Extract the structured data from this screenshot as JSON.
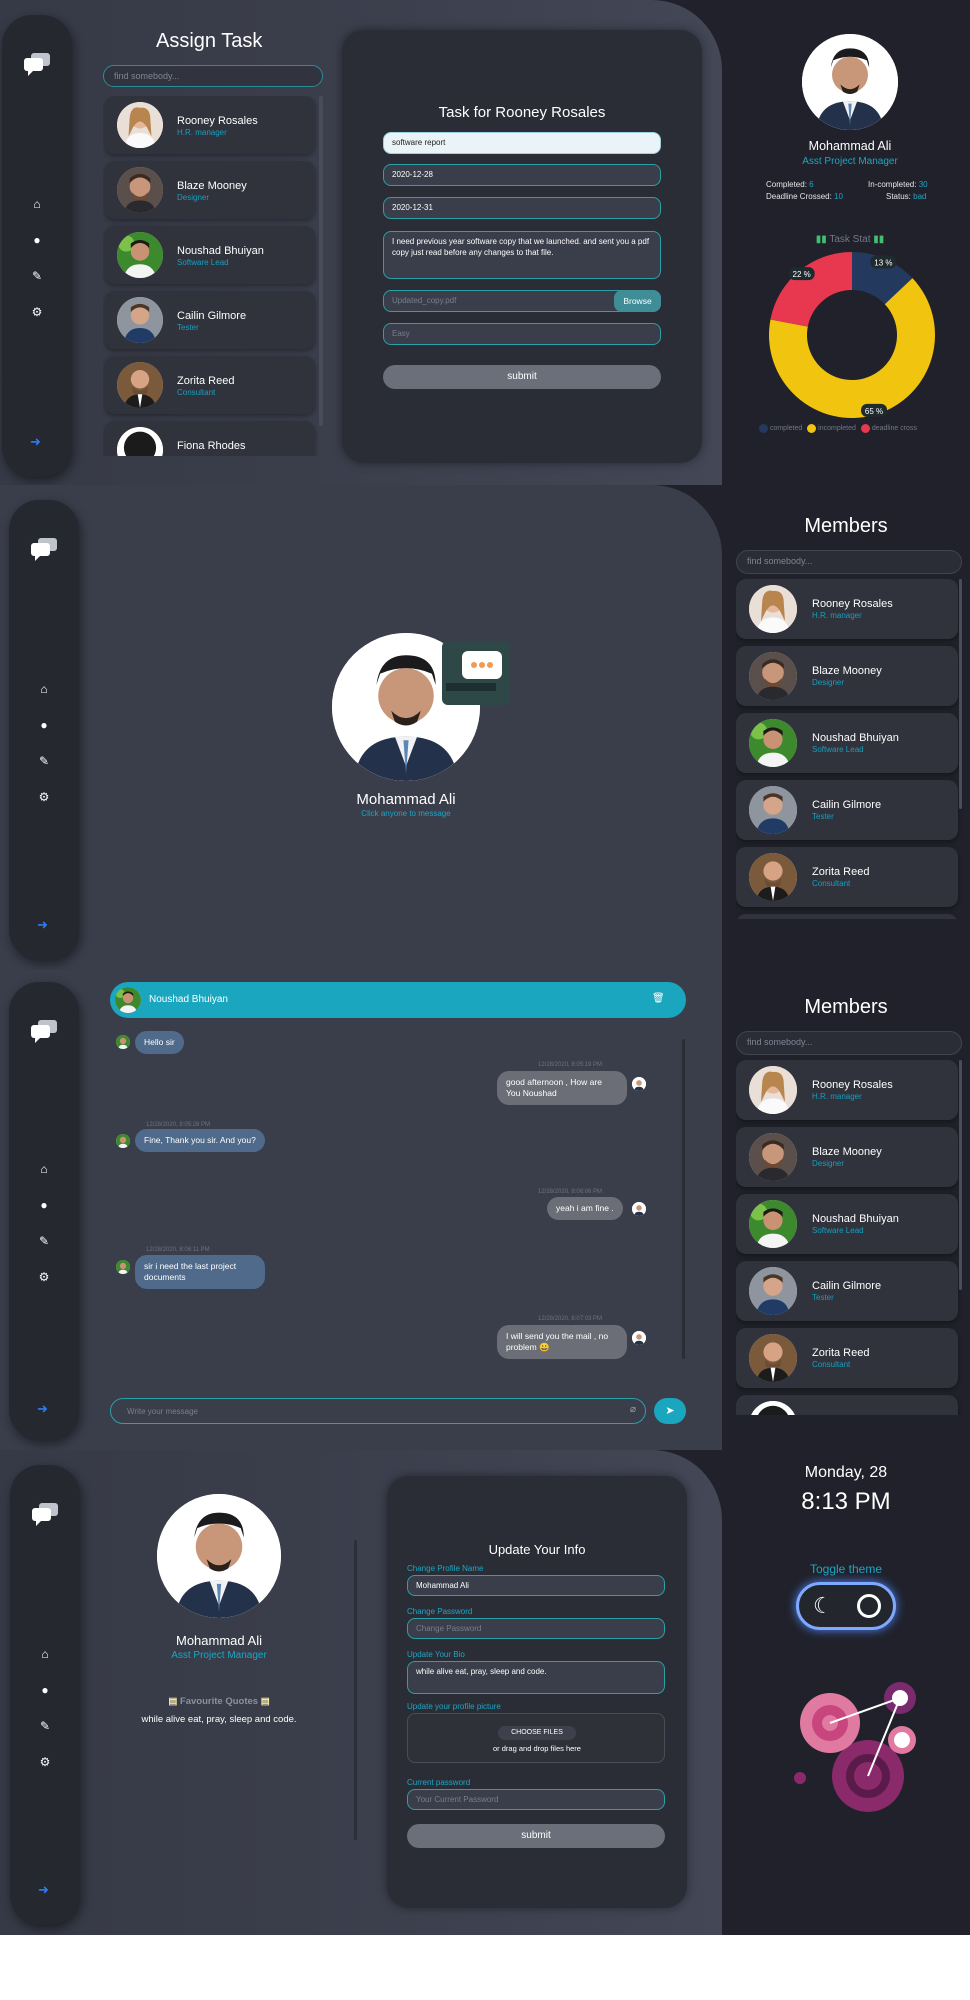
{
  "assign": {
    "title": "Assign Task",
    "search_placeholder": "find somebody...",
    "members": [
      {
        "name": "Rooney Rosales",
        "role": "H.R. manager"
      },
      {
        "name": "Blaze Mooney",
        "role": "Designer"
      },
      {
        "name": "Noushad Bhuiyan",
        "role": "Software Lead"
      },
      {
        "name": "Cailin Gilmore",
        "role": "Tester"
      },
      {
        "name": "Zorita Reed",
        "role": "Consultant"
      },
      {
        "name": "Fiona Rhodes",
        "role": ""
      }
    ],
    "form": {
      "title": "Task for Rooney Rosales",
      "task_value": "software report",
      "start_date": "2020-12-28",
      "end_date": "2020-12-31",
      "description": "I need previous year software copy that we launched. and  sent you a pdf copy just read before any changes to that file.",
      "file_placeholder": "Updated_copy.pdf",
      "browse_label": "Browse",
      "difficulty_placeholder": "Easy",
      "submit_label": "submit"
    }
  },
  "profile": {
    "name": "Mohammad Ali",
    "role": "Asst Project Manager",
    "completed_label": "Completed:",
    "completed_value": "6",
    "incompleted_label": "In-completed:",
    "incompleted_value": "30",
    "deadline_label": "Deadline Crossed:",
    "deadline_value": "10",
    "status_label": "Status:",
    "status_value": "bad",
    "task_stat_title": "Task Stat",
    "chart_data": {
      "type": "pie",
      "categories": [
        "completed",
        "incompleted",
        "deadline cross"
      ],
      "values": [
        13,
        65,
        22
      ],
      "colors": [
        "#233a5e",
        "#f1c40f",
        "#e8384f"
      ],
      "value_labels": [
        "13 %",
        "65 %",
        "22 %"
      ]
    }
  },
  "chat_home": {
    "name": "Mohammad Ali",
    "hint": "Click anyone to message"
  },
  "members_panel": {
    "title": "Members",
    "search_placeholder": "find somebody...",
    "members": [
      {
        "name": "Rooney Rosales",
        "role": "H.R. manager"
      },
      {
        "name": "Blaze Mooney",
        "role": "Designer"
      },
      {
        "name": "Noushad Bhuiyan",
        "role": "Software Lead"
      },
      {
        "name": "Cailin Gilmore",
        "role": "Tester"
      },
      {
        "name": "Zorita Reed",
        "role": "Consultant"
      }
    ]
  },
  "chat": {
    "contact_name": "Noushad Bhuiyan",
    "messages": [
      {
        "dir": "in",
        "text": "Hello sir",
        "time": ""
      },
      {
        "dir": "out",
        "text": "good afternoon , How are You Noushad",
        "time": "12/28/2020, 8:05:19 PM"
      },
      {
        "dir": "in",
        "text": "Fine, Thank you sir. And you?",
        "time": "12/28/2020, 8:05:28 PM"
      },
      {
        "dir": "out",
        "text": "yeah i am fine .",
        "time": "12/28/2020, 8:06:06 PM"
      },
      {
        "dir": "in",
        "text": "sir i need the last project documents",
        "time": "12/28/2020, 8:06:11 PM"
      },
      {
        "dir": "out",
        "text": "I will send you the mail , no problem 😀",
        "time": "12/28/2020, 8:07:03 PM"
      }
    ],
    "input_placeholder": "Write your message"
  },
  "settings": {
    "name": "Mohammad Ali",
    "role": "Asst Project Manager",
    "quotes_title": "Favourite Quotes",
    "quote": "while alive eat, pray, sleep and code.",
    "form": {
      "title": "Update Your Info",
      "name_label": "Change Profile Name",
      "name_value": "Mohammad Ali",
      "password_label": "Change Password",
      "password_placeholder": "Change Password",
      "bio_label": "Update Your Bio",
      "bio_value": "while alive eat, pray, sleep and code.",
      "picture_label": "Update your profile picture",
      "choose_label": "CHOOSE FILES",
      "drag_label": "or drag and drop files here",
      "current_label": "Current password",
      "current_placeholder": "Your Current Password",
      "submit_label": "submit"
    },
    "date": "Monday, 28",
    "time": "8:13 PM",
    "toggle_label": "Toggle theme"
  }
}
